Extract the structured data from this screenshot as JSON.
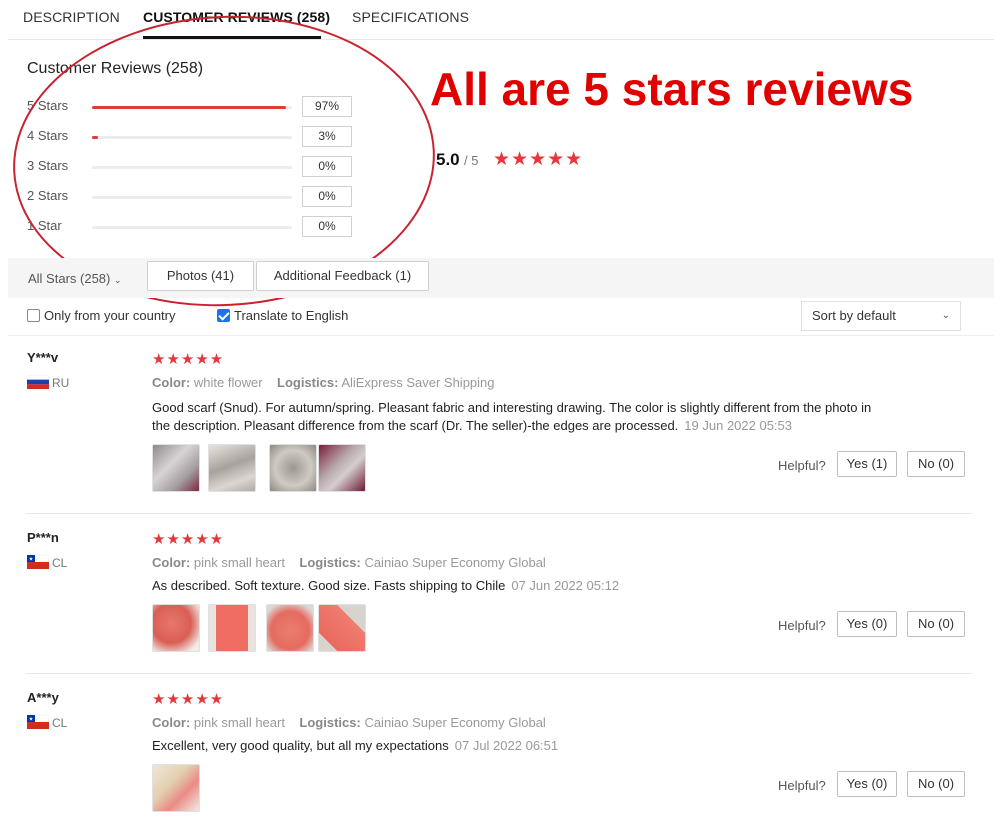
{
  "tabs": [
    "DESCRIPTION",
    "CUSTOMER REVIEWS (258)",
    "SPECIFICATIONS"
  ],
  "summary": {
    "title": "Customer Reviews (258)",
    "distribution": [
      {
        "label": "5 Stars",
        "pct": "97%",
        "fraction": 0.97
      },
      {
        "label": "4 Stars",
        "pct": "3%",
        "fraction": 0.03
      },
      {
        "label": "3 Stars",
        "pct": "0%",
        "fraction": 0
      },
      {
        "label": "2 Stars",
        "pct": "0%",
        "fraction": 0
      },
      {
        "label": "1 Star",
        "pct": "0%",
        "fraction": 0
      }
    ],
    "average": "5.0",
    "out_of": "/ 5",
    "stars": "★★★★★"
  },
  "annotation": "All are 5 stars reviews",
  "filters": {
    "all_stars": "All Stars (258)",
    "photos": "Photos (41)",
    "additional": "Additional Feedback (1)",
    "only_country": "Only from your country",
    "translate": "Translate to English",
    "sort": "Sort by default"
  },
  "colors": {
    "accent": "#e4393c",
    "annotation": "#e00000"
  },
  "reviews": [
    {
      "name": "Y***v",
      "country": "RU",
      "flag": "russia-flag-icon",
      "stars": "★★★★★",
      "color_label": "Color:",
      "color": "white flower",
      "logistics_label": "Logistics:",
      "logistics": "AliExpress Saver Shipping",
      "text": "Good scarf (Snud). For autumn/spring. Pleasant fabric and interesting drawing. The color is slightly different from the photo in the description. Pleasant difference from the scarf (Dr. The seller)-the edges are processed.",
      "date": "19 Jun 2022 05:53",
      "helpful_label": "Helpful?",
      "yes": "Yes (1)",
      "no": "No (0)"
    },
    {
      "name": "P***n",
      "country": "CL",
      "flag": "chile-flag-icon",
      "stars": "★★★★★",
      "color_label": "Color:",
      "color": "pink small heart",
      "logistics_label": "Logistics:",
      "logistics": "Cainiao Super Economy Global",
      "text": "As described. Soft texture. Good size. Fasts shipping to Chile",
      "date": "07 Jun 2022 05:12",
      "helpful_label": "Helpful?",
      "yes": "Yes (0)",
      "no": "No (0)"
    },
    {
      "name": "A***y",
      "country": "CL",
      "flag": "chile-flag-icon",
      "stars": "★★★★★",
      "color_label": "Color:",
      "color": "pink small heart",
      "logistics_label": "Logistics:",
      "logistics": "Cainiao Super Economy Global",
      "text": "Excellent, very good quality, but all my expectations",
      "date": "07 Jul 2022 06:51",
      "helpful_label": "Helpful?",
      "yes": "Yes (0)",
      "no": "No (0)"
    }
  ]
}
